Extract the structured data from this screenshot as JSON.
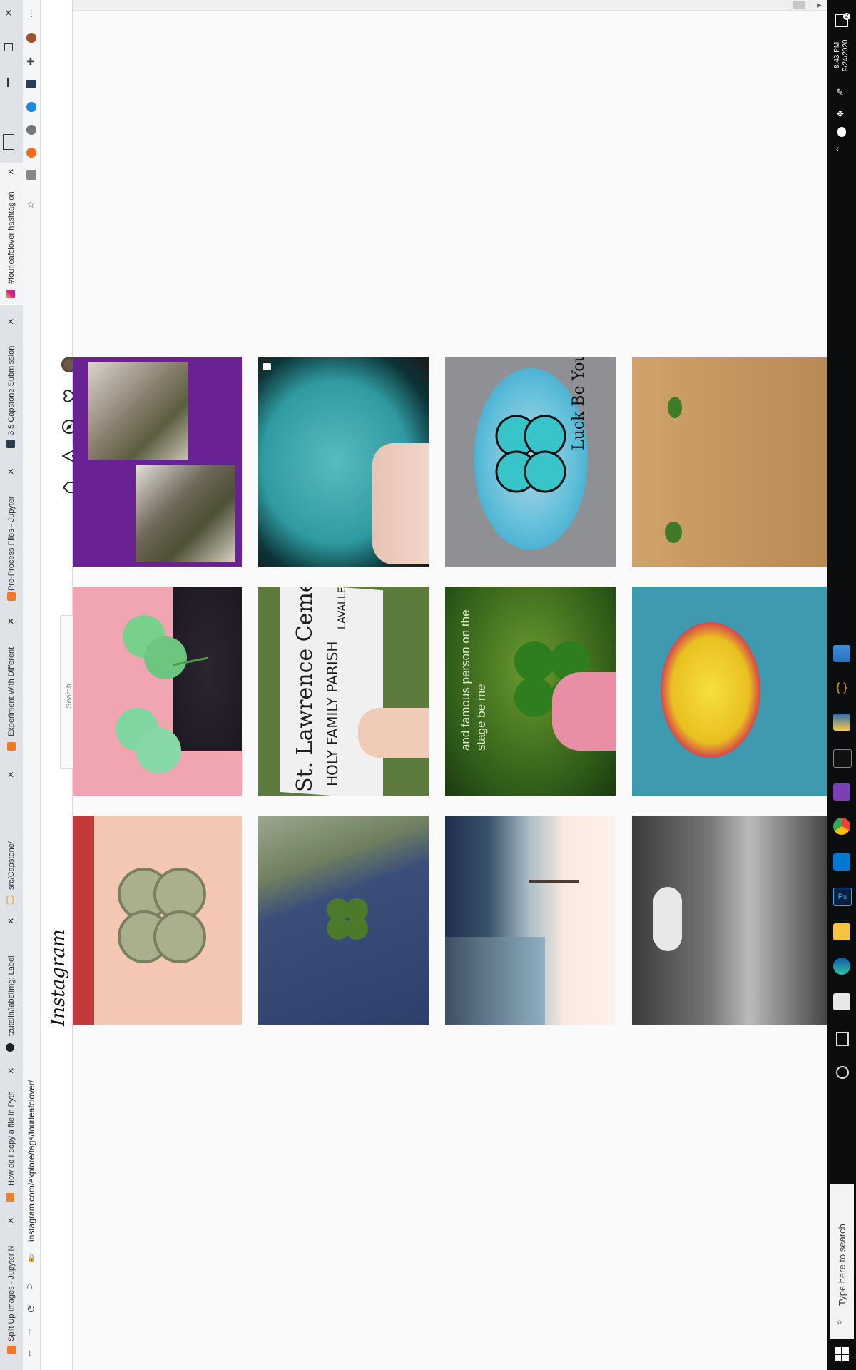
{
  "tabs": [
    {
      "label": "Split Up Images - Jupyter N",
      "active": false
    },
    {
      "label": "How do I copy a file in Pyth",
      "active": false
    },
    {
      "label": "tzutalin/labelImg: Label",
      "active": false
    },
    {
      "label": "src/Capstone/",
      "active": false
    },
    {
      "label": "Experiment With Different",
      "active": false
    },
    {
      "label": "Pre-Process Files - Jupyter",
      "active": false
    },
    {
      "label": "3.5 Capstone Submission",
      "active": false
    },
    {
      "label": "#fourleafclover hashtag on",
      "active": true
    }
  ],
  "address_bar": {
    "url": "instagram.com/explore/tags/fourleafclover/"
  },
  "instagram": {
    "logo": "Instagram",
    "search_placeholder": "Search"
  },
  "posts": [
    {
      "id": "post-couple-photos",
      "caption": ""
    },
    {
      "id": "post-glitter-coaster",
      "caption": ""
    },
    {
      "id": "post-painted-rock",
      "caption": "Luck Be Yours"
    },
    {
      "id": "post-wood-clover",
      "caption": ""
    },
    {
      "id": "post-clover-pot",
      "caption": ""
    },
    {
      "id": "post-cemetery-sign",
      "caption": "St. Lawrence Cemetery",
      "sign_sub": "HOLY FAMILY PARISH",
      "sign_sub2": "LAVALLE"
    },
    {
      "id": "post-clover-hand",
      "caption": "and famous person on the stage be me"
    },
    {
      "id": "post-mandala",
      "caption": ""
    },
    {
      "id": "post-embroidered",
      "caption": ""
    },
    {
      "id": "post-clover-denim",
      "caption": ""
    },
    {
      "id": "post-street",
      "caption": ""
    },
    {
      "id": "post-bw-flower",
      "caption": ""
    }
  ],
  "taskbar": {
    "search_placeholder": "Type here to search",
    "time": "8:43 PM",
    "date": "9/24/2020",
    "notification_count": "2"
  },
  "colors": {
    "instagram_purple": "#6a2192",
    "taskbar": "#0b0c0e",
    "clover_green": "#4caf50"
  }
}
